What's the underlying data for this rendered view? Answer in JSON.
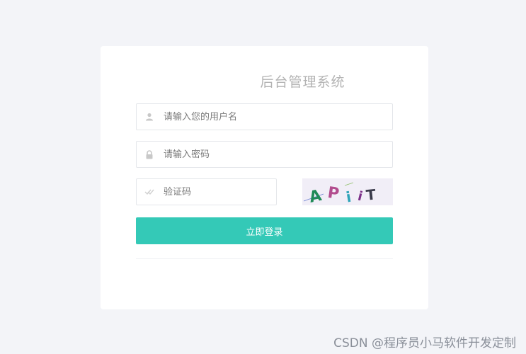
{
  "login": {
    "title": "后台管理系统",
    "username": {
      "placeholder": "请输入您的用户名",
      "icon": "user-icon"
    },
    "password": {
      "placeholder": "请输入密码",
      "icon": "lock-icon"
    },
    "captcha": {
      "placeholder": "验证码",
      "icon": "check-icon",
      "image_text": "APiiT"
    },
    "submit_label": "立即登录"
  },
  "watermark": "CSDN @程序员小马软件开发定制",
  "colors": {
    "background": "#f3f4f8",
    "card": "#ffffff",
    "accent": "#34c9b7",
    "title": "#b3b3b3"
  }
}
